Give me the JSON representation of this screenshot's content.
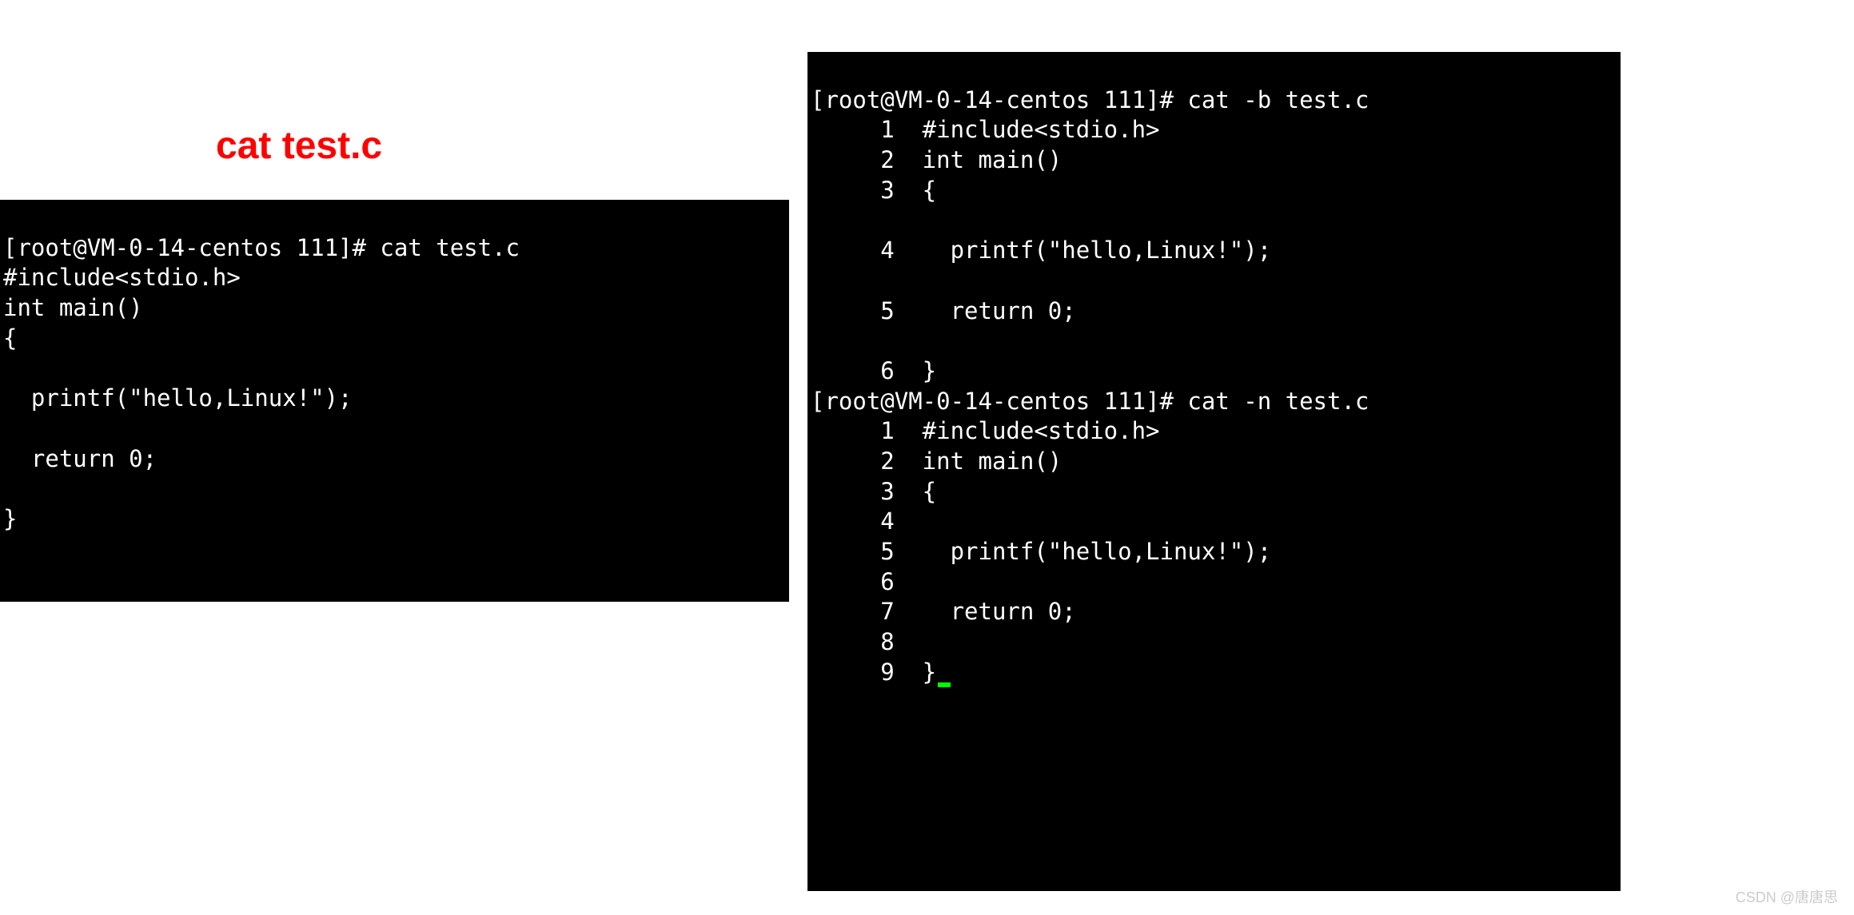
{
  "labels": {
    "left_title": "cat test.c",
    "right_b": "cat -b",
    "right_n": "cat -n"
  },
  "left_terminal": {
    "prompt": "[root@VM-0-14-centos 111]# cat test.c",
    "lines": [
      "#include<stdio.h>",
      "int main()",
      "{",
      "",
      "  printf(\"hello,Linux!\");",
      "",
      "  return 0;",
      "",
      "}"
    ]
  },
  "right_terminal": {
    "prompt_b": "[root@VM-0-14-centos 111]# cat -b test.c",
    "b_lines": [
      "     1  #include<stdio.h>",
      "     2  int main()",
      "     3  {",
      "",
      "     4    printf(\"hello,Linux!\");",
      "",
      "     5    return 0;",
      "",
      "     6  }"
    ],
    "prompt_n": "[root@VM-0-14-centos 111]# cat -n test.c",
    "n_lines": [
      "     1  #include<stdio.h>",
      "     2  int main()",
      "     3  {",
      "     4",
      "     5    printf(\"hello,Linux!\");",
      "     6",
      "     7    return 0;",
      "     8",
      "     9  }"
    ]
  },
  "watermark": "CSDN @唐唐思"
}
